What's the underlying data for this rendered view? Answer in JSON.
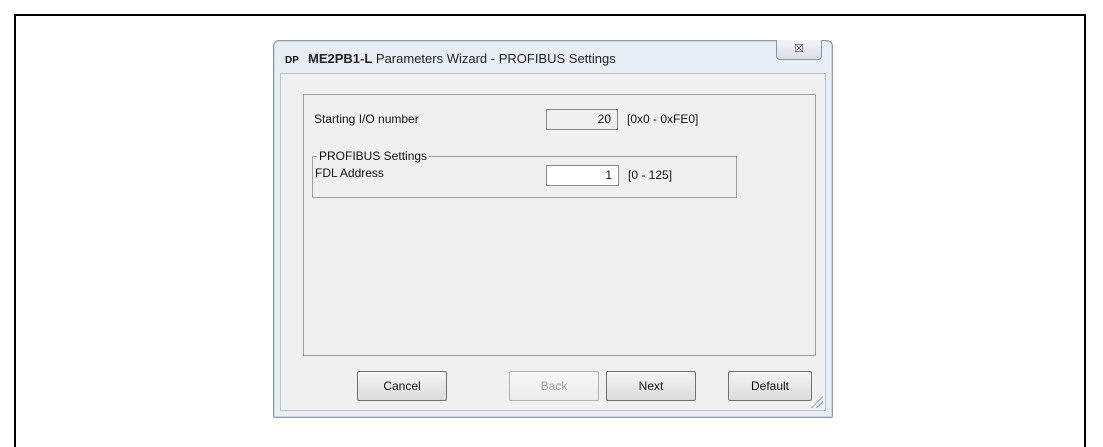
{
  "window": {
    "icon_text": "DP",
    "title_model": "ME2PB1-L",
    "title_rest": " Parameters Wizard - PROFIBUS Settings",
    "close_glyph": "☒"
  },
  "fields": {
    "starting_io": {
      "label": "Starting I/O number",
      "value": "20",
      "range": "[0x0 - 0xFE0]"
    },
    "group_title": "PROFIBUS Settings",
    "fdl_address": {
      "label": "FDL Address",
      "value": "1",
      "range": "[0 - 125]"
    }
  },
  "buttons": {
    "cancel": "Cancel",
    "back": "Back",
    "next": "Next",
    "default": "Default"
  }
}
